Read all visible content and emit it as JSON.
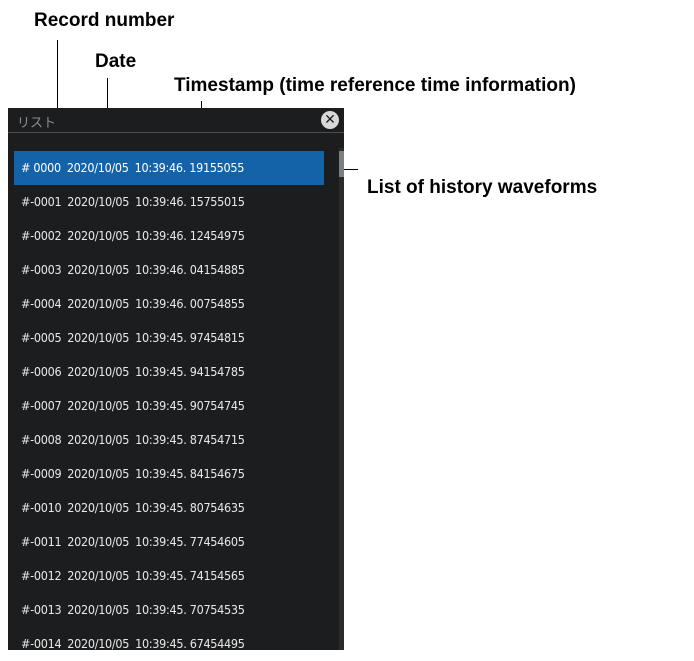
{
  "callouts": {
    "record_number": "Record number",
    "date": "Date",
    "timestamp": "Timestamp (time reference time information)",
    "history_list": "List of history waveforms"
  },
  "panel": {
    "title": "リスト",
    "close_icon": "close-icon"
  },
  "rows": [
    {
      "record": "# 0000",
      "date": "2020/10/05",
      "time": "10:39:46. 19155055",
      "selected": true
    },
    {
      "record": "#-0001",
      "date": "2020/10/05",
      "time": "10:39:46. 15755015"
    },
    {
      "record": "#-0002",
      "date": "2020/10/05",
      "time": "10:39:46. 12454975"
    },
    {
      "record": "#-0003",
      "date": "2020/10/05",
      "time": "10:39:46. 04154885"
    },
    {
      "record": "#-0004",
      "date": "2020/10/05",
      "time": "10:39:46. 00754855"
    },
    {
      "record": "#-0005",
      "date": "2020/10/05",
      "time": "10:39:45. 97454815"
    },
    {
      "record": "#-0006",
      "date": "2020/10/05",
      "time": "10:39:45. 94154785"
    },
    {
      "record": "#-0007",
      "date": "2020/10/05",
      "time": "10:39:45. 90754745"
    },
    {
      "record": "#-0008",
      "date": "2020/10/05",
      "time": "10:39:45. 87454715"
    },
    {
      "record": "#-0009",
      "date": "2020/10/05",
      "time": "10:39:45. 84154675"
    },
    {
      "record": "#-0010",
      "date": "2020/10/05",
      "time": "10:39:45. 80754635"
    },
    {
      "record": "#-0011",
      "date": "2020/10/05",
      "time": "10:39:45. 77454605"
    },
    {
      "record": "#-0012",
      "date": "2020/10/05",
      "time": "10:39:45. 74154565"
    },
    {
      "record": "#-0013",
      "date": "2020/10/05",
      "time": "10:39:45. 70754535"
    },
    {
      "record": "#-0014",
      "date": "2020/10/05",
      "time": "10:39:45. 67454495"
    }
  ],
  "colors": {
    "panel_bg": "#1c1d1e",
    "selected_row": "#1463a8",
    "row_text": "#e8e8e8"
  }
}
